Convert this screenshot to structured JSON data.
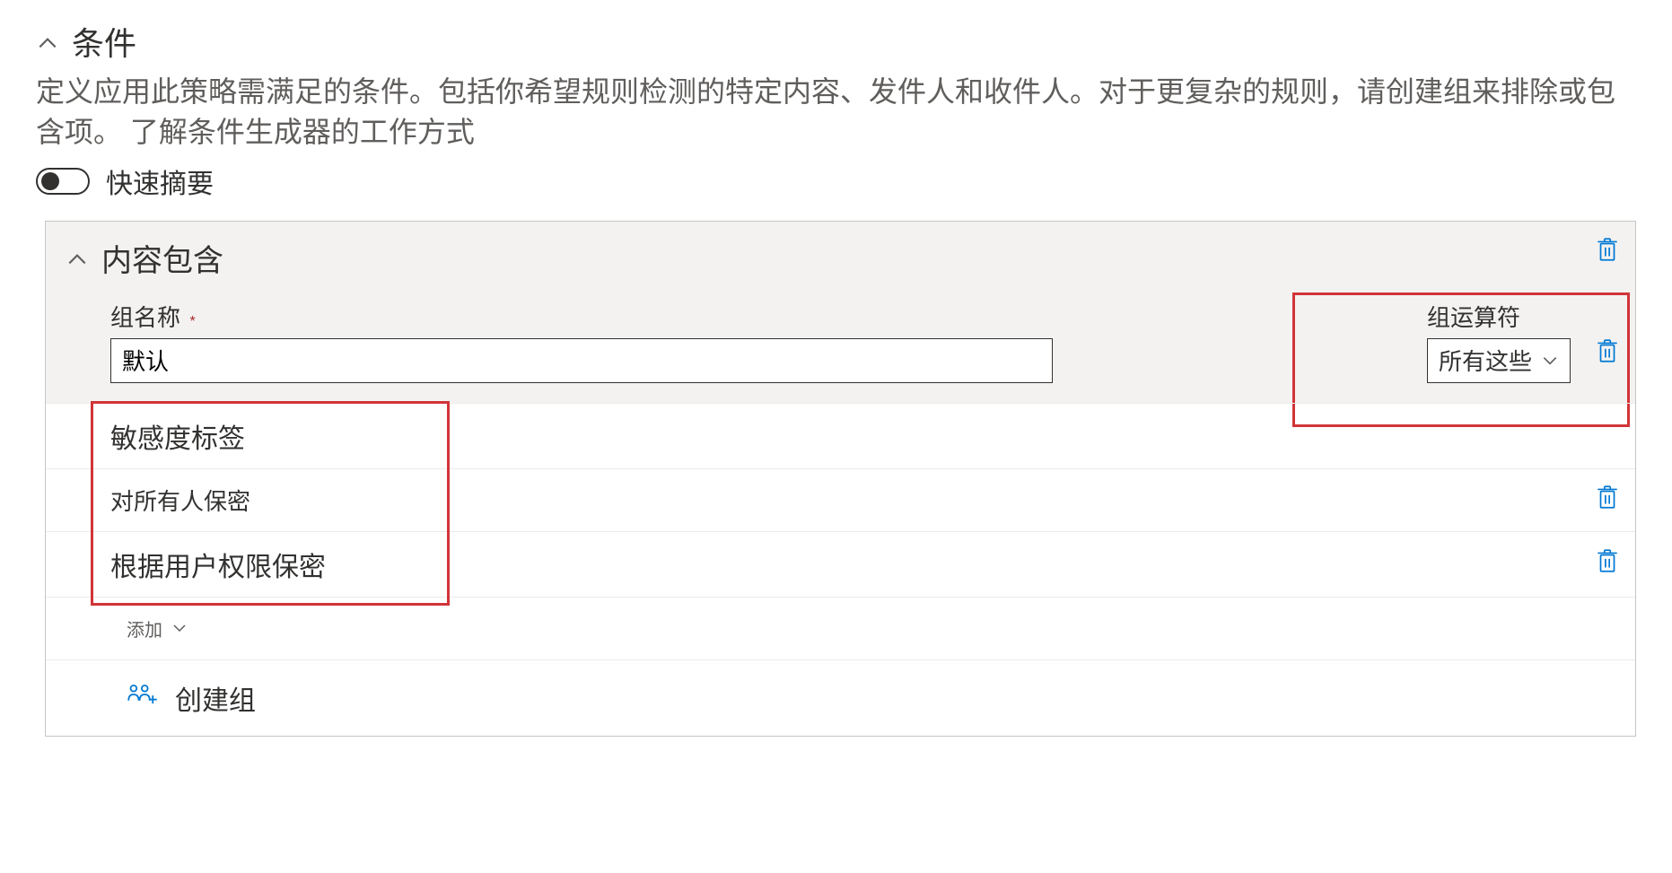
{
  "section": {
    "title": "条件",
    "description_part1": "定义应用此策略需满足的条件。包括你希望规则检测的特定内容、发件人和收件人。对于更复杂的规则，请创建组来排除或包含项。",
    "description_link": "了解条件生成器的工作方式"
  },
  "toggle": {
    "label": "快速摘要"
  },
  "panel": {
    "title": "内容包含"
  },
  "group": {
    "name_label": "组名称",
    "name_value": "默认",
    "operator_label": "组运算符",
    "operator_value": "所有这些"
  },
  "category": {
    "label": "敏感度标签"
  },
  "items": [
    {
      "label": "对所有人保密"
    },
    {
      "label": "根据用户权限保密"
    }
  ],
  "add_label": "添加",
  "create_group_label": "创建组"
}
